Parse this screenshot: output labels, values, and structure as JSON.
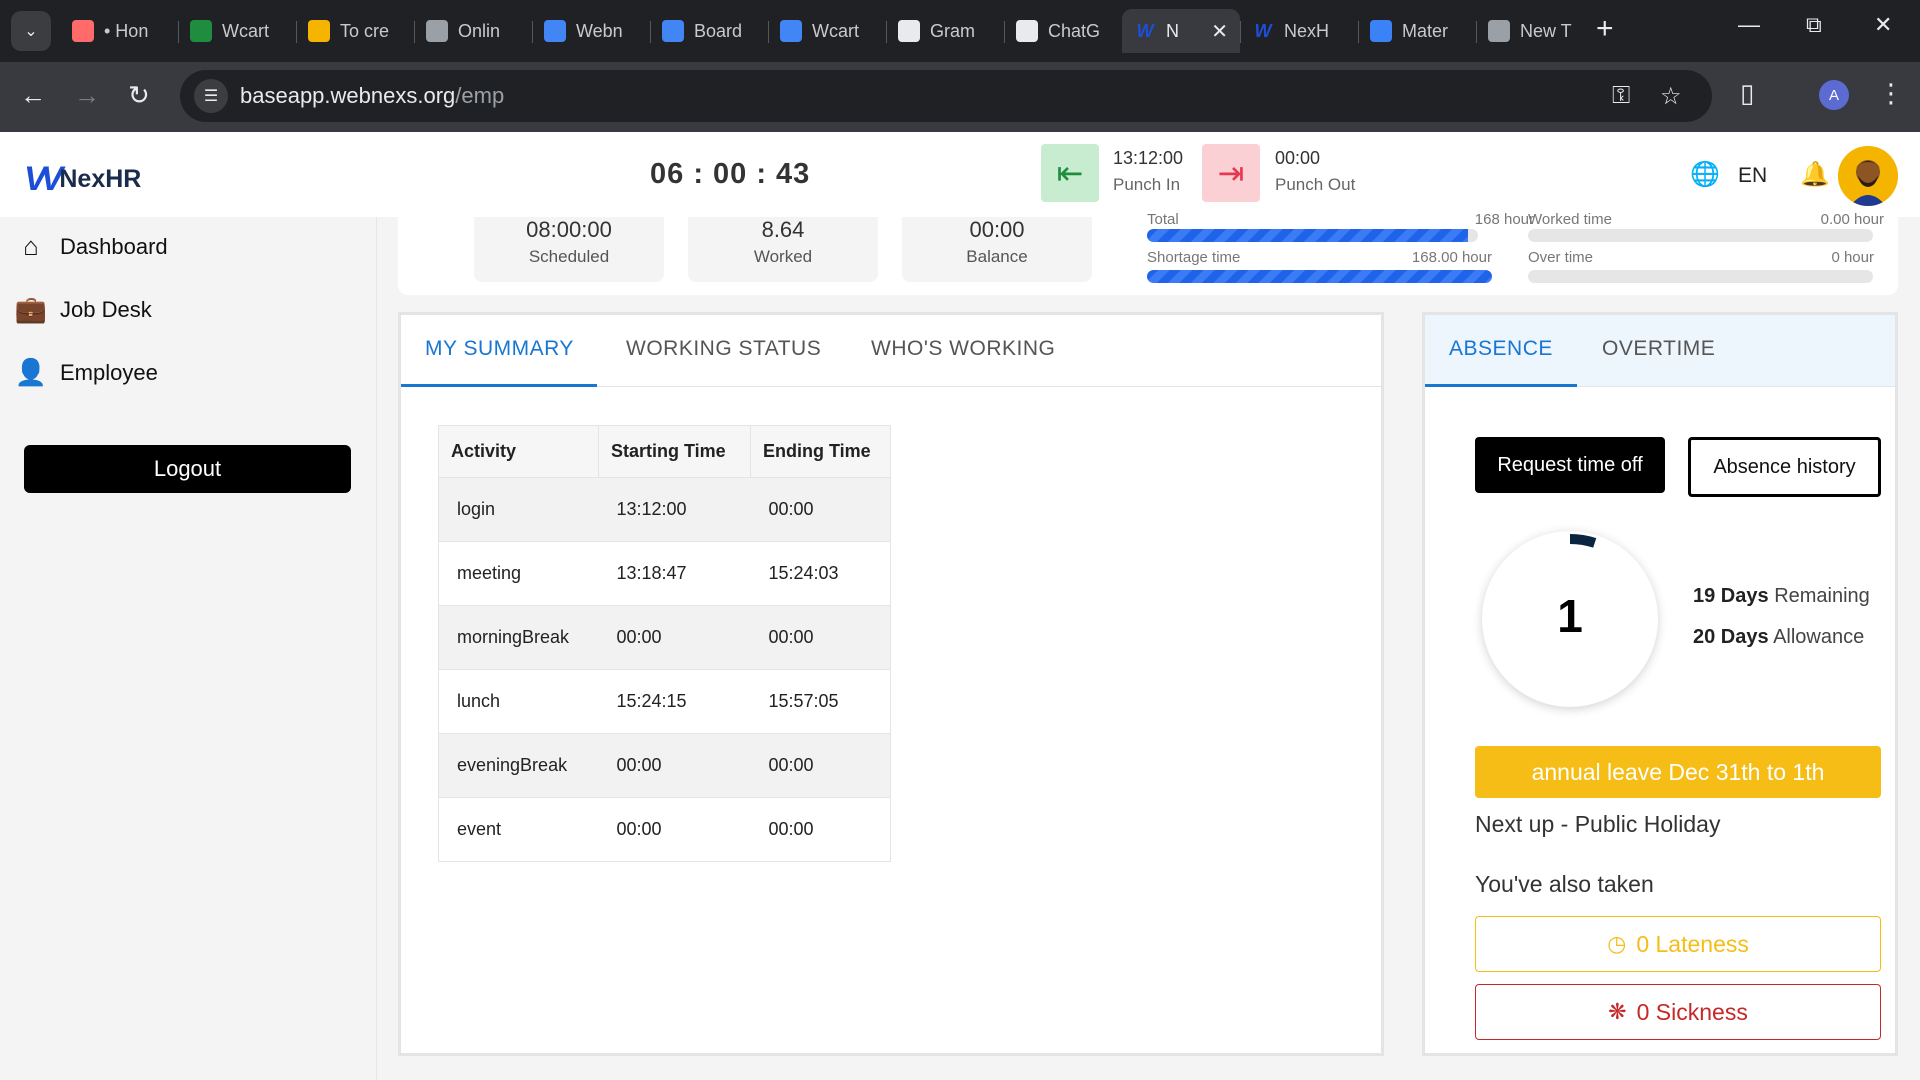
{
  "browser": {
    "tabs": [
      {
        "title": "• Hon",
        "icon": "dots-icon",
        "color": "#ff6b6b"
      },
      {
        "title": "Wcart",
        "icon": "sheets-icon",
        "color": "#1e8e3e"
      },
      {
        "title": "To cre",
        "icon": "emoji-icon",
        "color": "#f4b400"
      },
      {
        "title": "Onlin",
        "icon": "spiral-icon",
        "color": "#9aa0a6"
      },
      {
        "title": "Webn",
        "icon": "docs-icon",
        "color": "#4285f4"
      },
      {
        "title": "Board",
        "icon": "docs-icon",
        "color": "#4285f4"
      },
      {
        "title": "Wcart",
        "icon": "docs-icon",
        "color": "#4285f4"
      },
      {
        "title": "Gram",
        "icon": "chart-icon",
        "color": "#e8eaed"
      },
      {
        "title": "ChatG",
        "icon": "chatgpt-icon",
        "color": "#e8eaed"
      },
      {
        "title": "N",
        "icon": "nexhr-icon",
        "color": "#1d4ed8",
        "active": true
      },
      {
        "title": "NexH",
        "icon": "nexhr-icon",
        "color": "#1d4ed8"
      },
      {
        "title": "Mater",
        "icon": "mui-icon",
        "color": "#3b82f6"
      },
      {
        "title": "New T",
        "icon": "chrome-icon",
        "color": "#9aa0a6"
      }
    ],
    "url_host": "baseapp.webnexs.org",
    "url_path": "/emp",
    "profile_initial": "A"
  },
  "header": {
    "brand": "NexHR",
    "clock": "06 : 00 : 43",
    "punch_in_time": "13:12:00",
    "punch_in_label": "Punch In",
    "punch_out_time": "00:00",
    "punch_out_label": "Punch Out",
    "language": "EN"
  },
  "sidebar": {
    "items": [
      {
        "label": "Dashboard",
        "icon": "home-icon"
      },
      {
        "label": "Job Desk",
        "icon": "briefcase-icon"
      },
      {
        "label": "Employee",
        "icon": "person-icon"
      }
    ],
    "logout_label": "Logout"
  },
  "stats": {
    "scheduled_value": "08:00:00",
    "scheduled_label": "Scheduled",
    "worked_value": "8.64",
    "worked_label": "Worked",
    "balance_value": "00:00",
    "balance_label": "Balance",
    "total_label": "Total",
    "total_value": "168 hour",
    "total_fill": 0.97,
    "worked_time_label": "Worked time",
    "worked_time_value": "0.00 hour",
    "worked_time_fill": 0,
    "shortage_label": "Shortage time",
    "shortage_value": "168.00 hour",
    "shortage_fill": 1.0,
    "overtime_label": "Over time",
    "overtime_value": "0 hour",
    "overtime_fill": 0
  },
  "summary": {
    "tabs": [
      "MY SUMMARY",
      "WORKING STATUS",
      "WHO'S WORKING"
    ],
    "columns": [
      "Activity",
      "Starting Time",
      "Ending Time"
    ],
    "rows": [
      [
        "login",
        "13:12:00",
        "00:00"
      ],
      [
        "meeting",
        "13:18:47",
        "15:24:03"
      ],
      [
        "morningBreak",
        "00:00",
        "00:00"
      ],
      [
        "lunch",
        "15:24:15",
        "15:57:05"
      ],
      [
        "eveningBreak",
        "00:00",
        "00:00"
      ],
      [
        "event",
        "00:00",
        "00:00"
      ]
    ]
  },
  "absence": {
    "tabs": [
      "ABSENCE",
      "OVERTIME"
    ],
    "request_label": "Request time off",
    "history_label": "Absence history",
    "taken_count": "1",
    "taken_fraction": 0.05,
    "remaining_days": "19 Days",
    "remaining_label": "Remaining",
    "allowance_days": "20 Days",
    "allowance_label": "Allowance",
    "leave_banner": "annual leave Dec 31th to 1th",
    "next_up": "Next up - Public Holiday",
    "also_taken": "You've also taken",
    "lateness": "0 Lateness",
    "sickness": "0 Sickness",
    "accent": "#f6bd16",
    "danger": "#c62828"
  }
}
